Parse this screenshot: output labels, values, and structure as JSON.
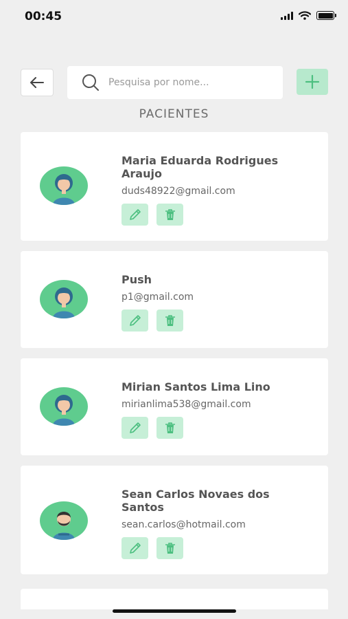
{
  "status": {
    "time": "00:45"
  },
  "search": {
    "placeholder": "Pesquisa por nome..."
  },
  "section_title": "PACIENTES",
  "patients": [
    {
      "name": "Maria Eduarda Rodrigues Araujo",
      "email": "duds48922@gmail.com",
      "avatar": "female-avatar"
    },
    {
      "name": "Push",
      "email": "p1@gmail.com",
      "avatar": "female-avatar"
    },
    {
      "name": "Mirian Santos Lima Lino",
      "email": "mirianlima538@gmail.com",
      "avatar": "female-avatar"
    },
    {
      "name": "Sean Carlos Novaes dos Santos",
      "email": "sean.carlos@hotmail.com",
      "avatar": "male-avatar"
    }
  ],
  "icons": {
    "back": "arrow-left-icon",
    "search": "search-icon",
    "add": "plus-icon",
    "edit": "pencil-icon",
    "delete": "trash-icon"
  },
  "colors": {
    "accent": "#5fcc8e",
    "accent_light": "#c6efd7",
    "background": "#efefef"
  }
}
